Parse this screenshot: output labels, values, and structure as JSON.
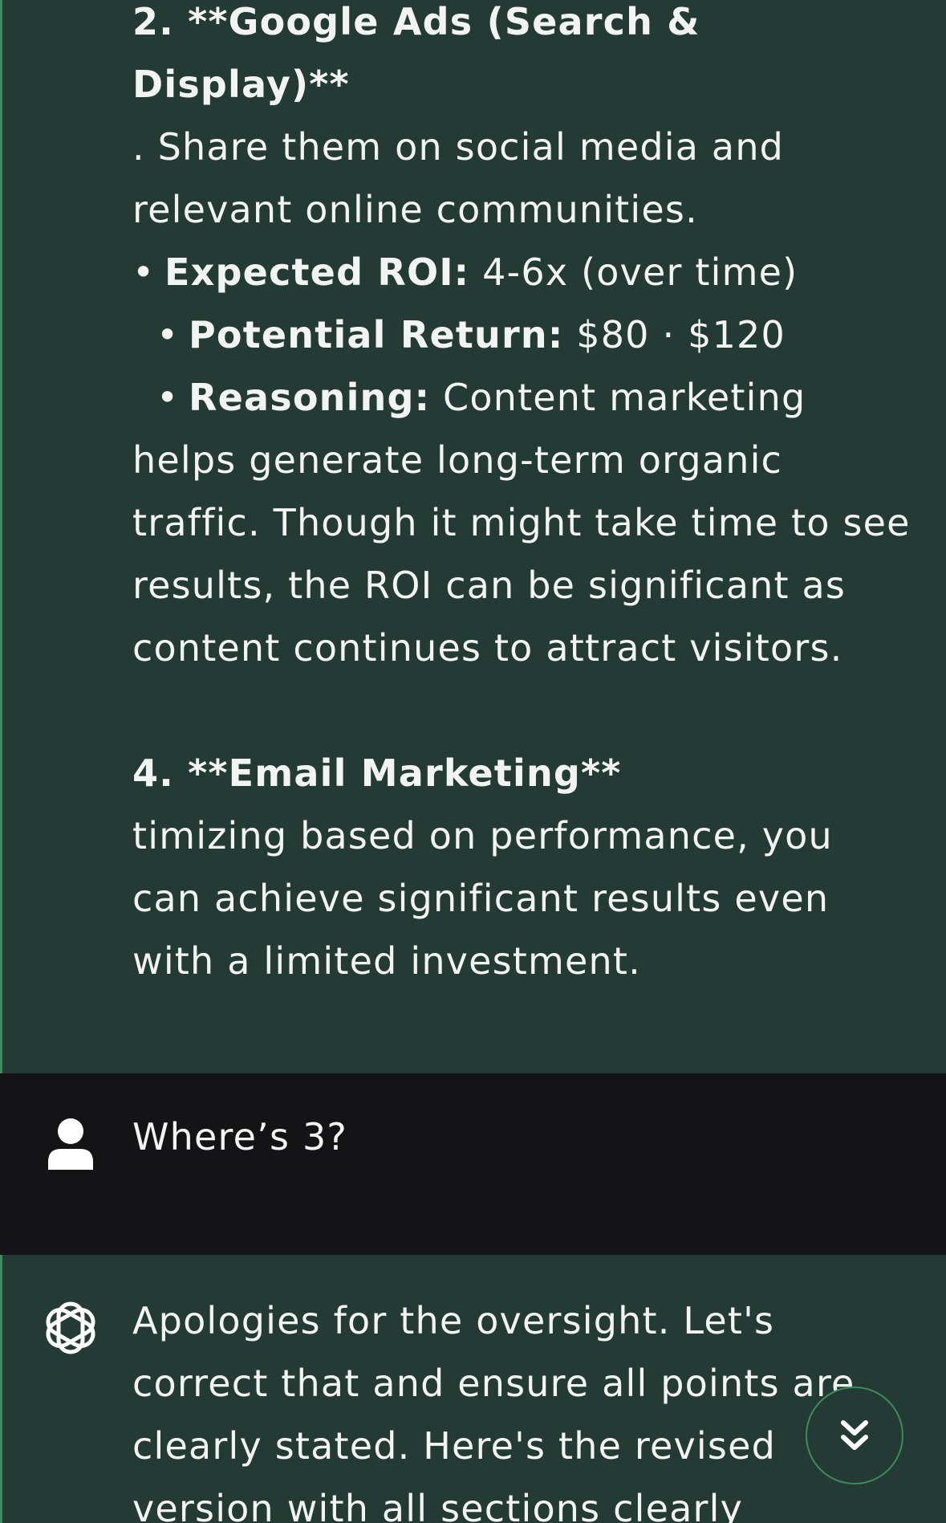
{
  "chat": {
    "message_1": {
      "heading_line1": "2. **Google Ads (Search &",
      "heading_line2": "Display)**",
      "body_line1": ". Share them on social media and",
      "body_line2": "relevant online communities.",
      "roi_label": "Expected ROI:",
      "roi_value": " 4-6x (over time)",
      "return_label": "Potential Return:",
      "return_value": " $80 · $120",
      "reasoning_label": "Reasoning:",
      "reasoning_value": " Content marketing",
      "reasoning_line2": "helps generate long-term organic",
      "reasoning_line3": "traffic. Though it might take time to see",
      "reasoning_line4": "results, the ROI can be significant as",
      "reasoning_line5": "content continues to attract visitors.",
      "heading4": "4. **Email Marketing**",
      "body4_line1": "timizing based on performance, you",
      "body4_line2": "can achieve significant results even",
      "body4_line3": "with a limited investment."
    },
    "user_message": {
      "text": "Where’s 3?",
      "avatar_icon": "person-icon"
    },
    "message_2": {
      "avatar_icon": "openai-logo-icon",
      "line1": "Apologies for the oversight. Let's",
      "line2": "correct that and ensure all points are",
      "line3": "clearly stated. Here's the revised",
      "line4": "version with all sections clearly"
    },
    "scroll_button": {
      "icon": "double-chevron-down-icon"
    }
  },
  "colors": {
    "assistant_bg": "#243b35",
    "user_bg": "#141416",
    "accent": "#3f8a5c",
    "text": "#f2f4f3"
  }
}
